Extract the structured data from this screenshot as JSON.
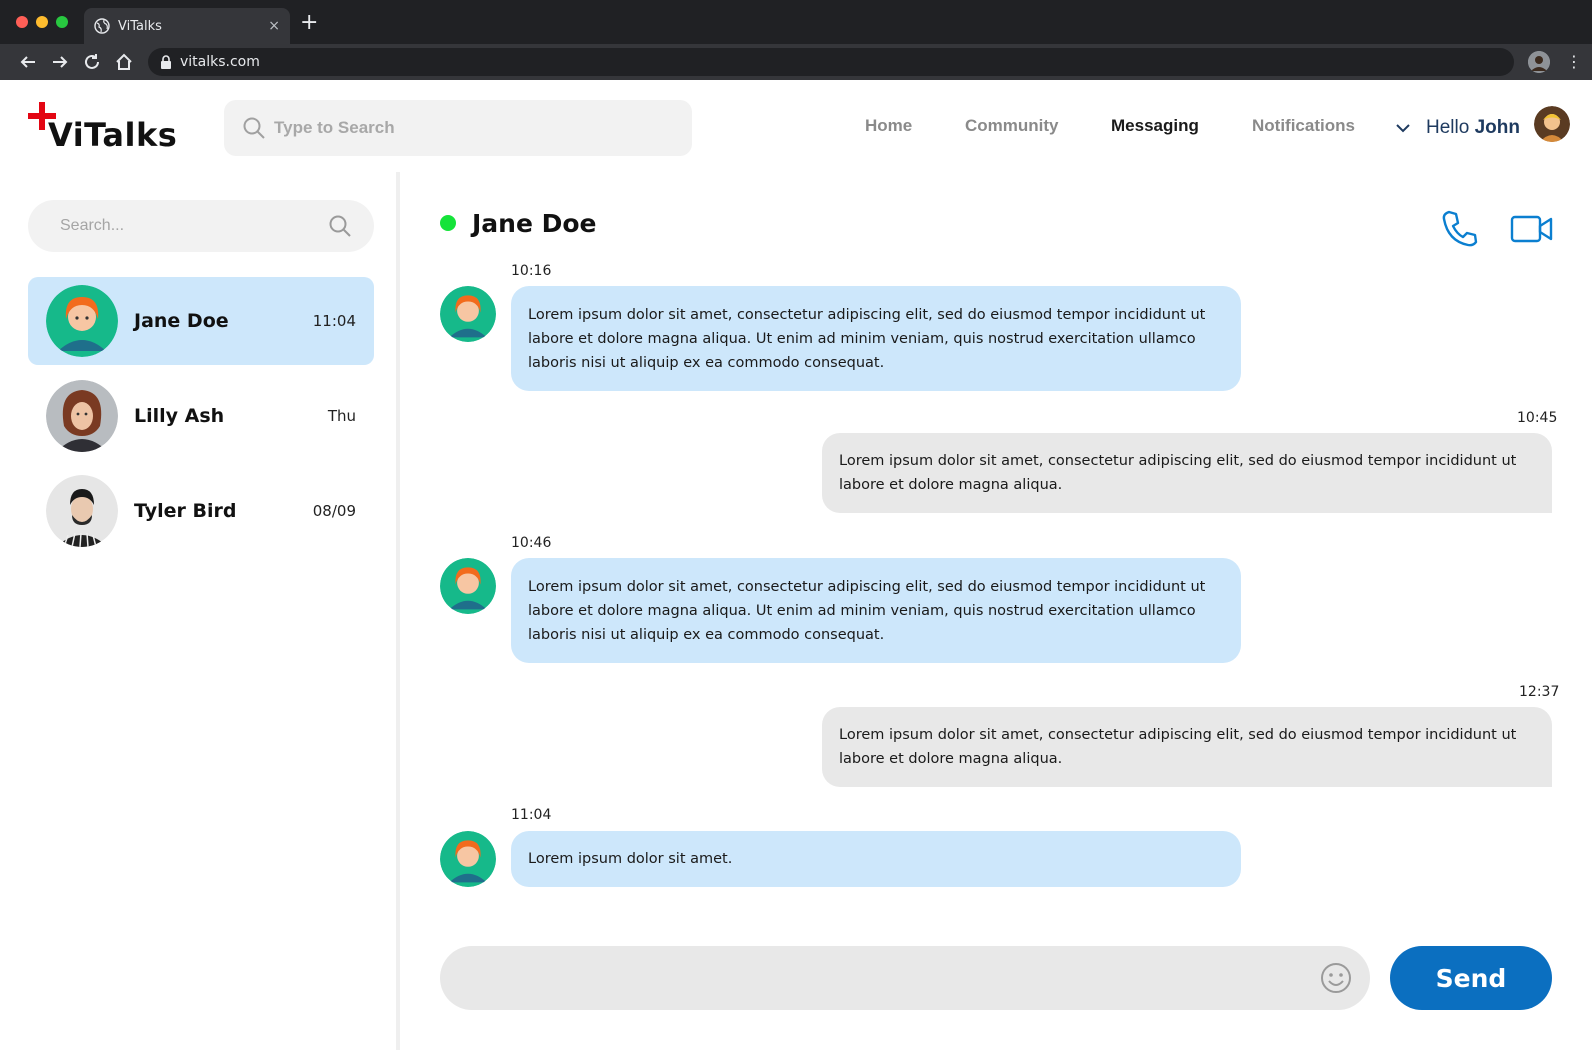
{
  "browser": {
    "tab_title": "ViTalks",
    "tab_close": "×",
    "new_tab": "+",
    "url": "vitalks.com"
  },
  "header": {
    "logo_text": "ViTalks",
    "search_placeholder": "Type to Search",
    "nav": [
      "Home",
      "Community",
      "Messaging",
      "Notifications"
    ],
    "active_nav": "Messaging",
    "greeting": "Hello",
    "user_name": "John"
  },
  "sidebar": {
    "search_placeholder": "Search...",
    "contacts": [
      {
        "name": "Jane Doe",
        "time": "11:04",
        "active": true
      },
      {
        "name": "Lilly Ash",
        "time": "Thu",
        "active": false
      },
      {
        "name": "Tyler Bird",
        "time": "08/09",
        "active": false
      }
    ]
  },
  "chat": {
    "contact_name": "Jane Doe",
    "status": "online",
    "messages": [
      {
        "time": "10:16",
        "direction": "in",
        "text": "Lorem ipsum dolor sit amet, consectetur adipiscing elit, sed do eiusmod tempor incididunt ut labore et dolore magna aliqua. Ut enim ad minim veniam, quis nostrud exercitation ullamco laboris nisi ut aliquip ex ea commodo consequat."
      },
      {
        "time": "10:45",
        "direction": "out",
        "text": "Lorem ipsum dolor sit amet, consectetur adipiscing elit, sed do eiusmod tempor incididunt ut labore et dolore magna aliqua."
      },
      {
        "time": "10:46",
        "direction": "in",
        "text": "Lorem ipsum dolor sit amet, consectetur adipiscing elit, sed do eiusmod tempor incididunt ut labore et dolore magna aliqua. Ut enim ad minim veniam, quis nostrud exercitation ullamco laboris nisi ut aliquip ex ea commodo consequat."
      },
      {
        "time": "12:37",
        "direction": "out",
        "text": "Lorem ipsum dolor sit amet, consectetur adipiscing elit, sed do eiusmod tempor incididunt ut labore et dolore magna aliqua."
      },
      {
        "time": "11:04",
        "direction": "in",
        "text": "Lorem ipsum dolor sit amet."
      }
    ],
    "composer_value": "",
    "send_label": "Send"
  },
  "colors": {
    "accent": "#0b6fc0",
    "logo_red": "#e30613",
    "incoming_bubble": "#cde7fb",
    "outgoing_bubble": "#e8e8e8",
    "online": "#15e33a"
  },
  "icons": [
    "globe-icon",
    "close-icon",
    "plus-icon",
    "back-icon",
    "forward-icon",
    "reload-icon",
    "home-icon",
    "lock-icon",
    "kebab-menu-icon",
    "search-icon",
    "chevron-down-icon",
    "phone-icon",
    "video-camera-icon",
    "emoji-icon"
  ]
}
